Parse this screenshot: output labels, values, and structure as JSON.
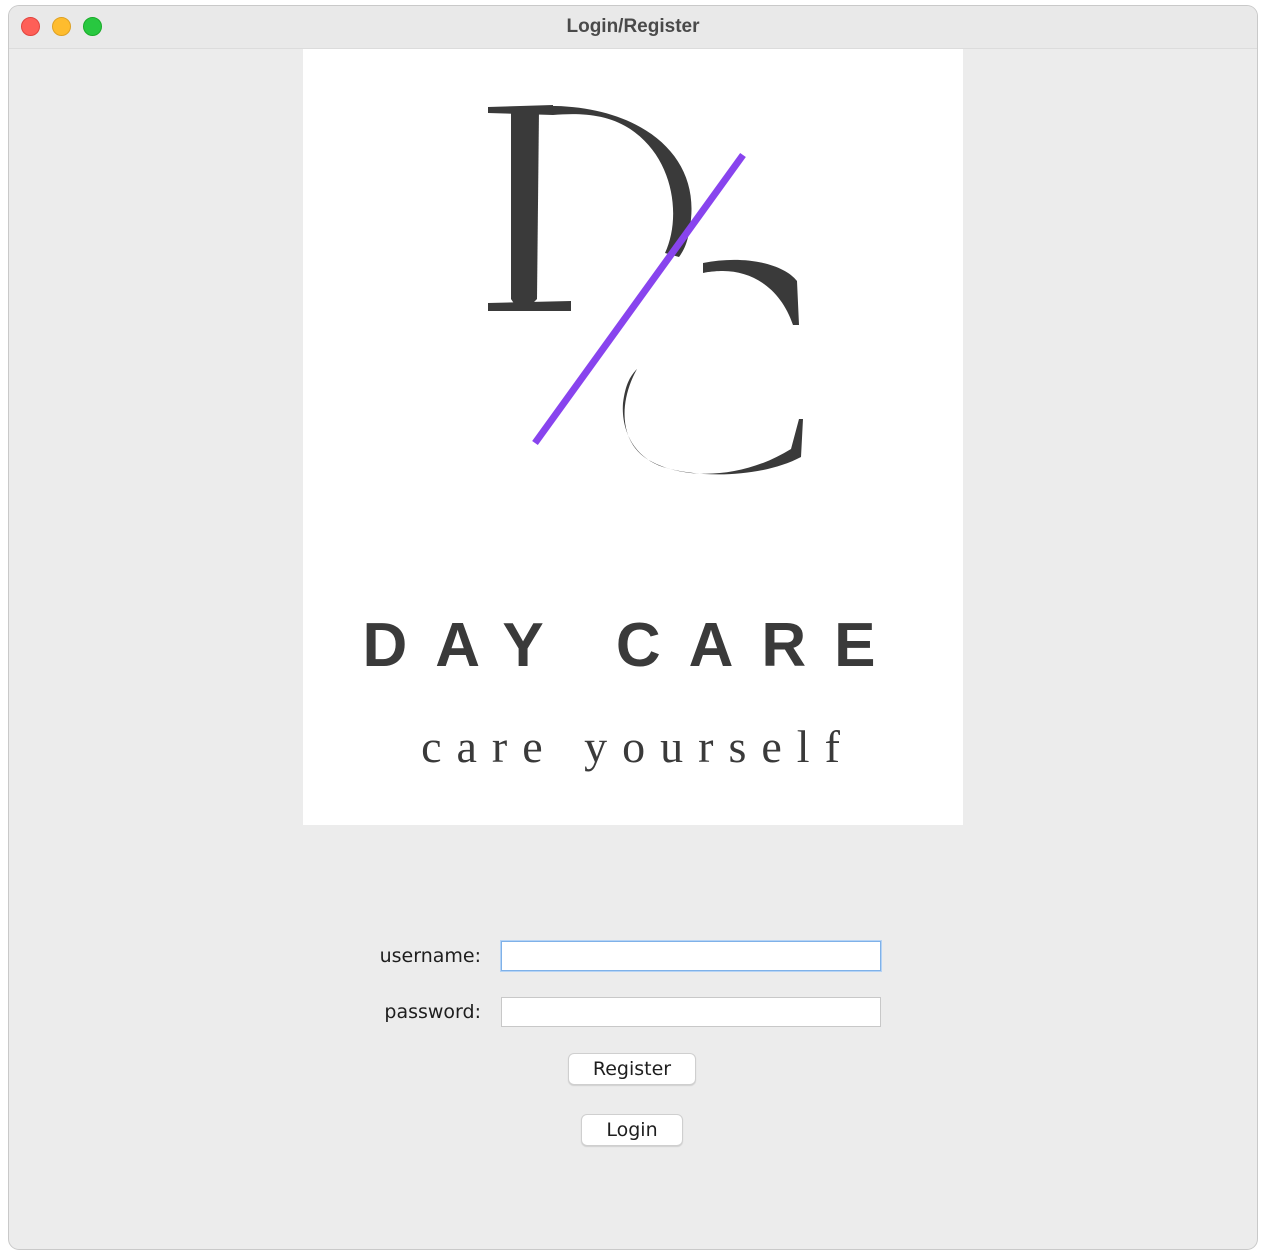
{
  "window": {
    "title": "Login/Register"
  },
  "logo": {
    "monogram": "DC",
    "brand_name": "DAY CARE",
    "tagline": "care yourself",
    "accent_color": "#8844ee",
    "ink_color": "#3a3a3a"
  },
  "form": {
    "username_label": "username:",
    "username_value": "",
    "password_label": "password:",
    "password_value": ""
  },
  "buttons": {
    "register_label": "Register",
    "login_label": "Login"
  },
  "colors": {
    "window_bg": "#ececec",
    "close": "#fe5f57",
    "minimize": "#febc2e",
    "zoom": "#28c840"
  }
}
